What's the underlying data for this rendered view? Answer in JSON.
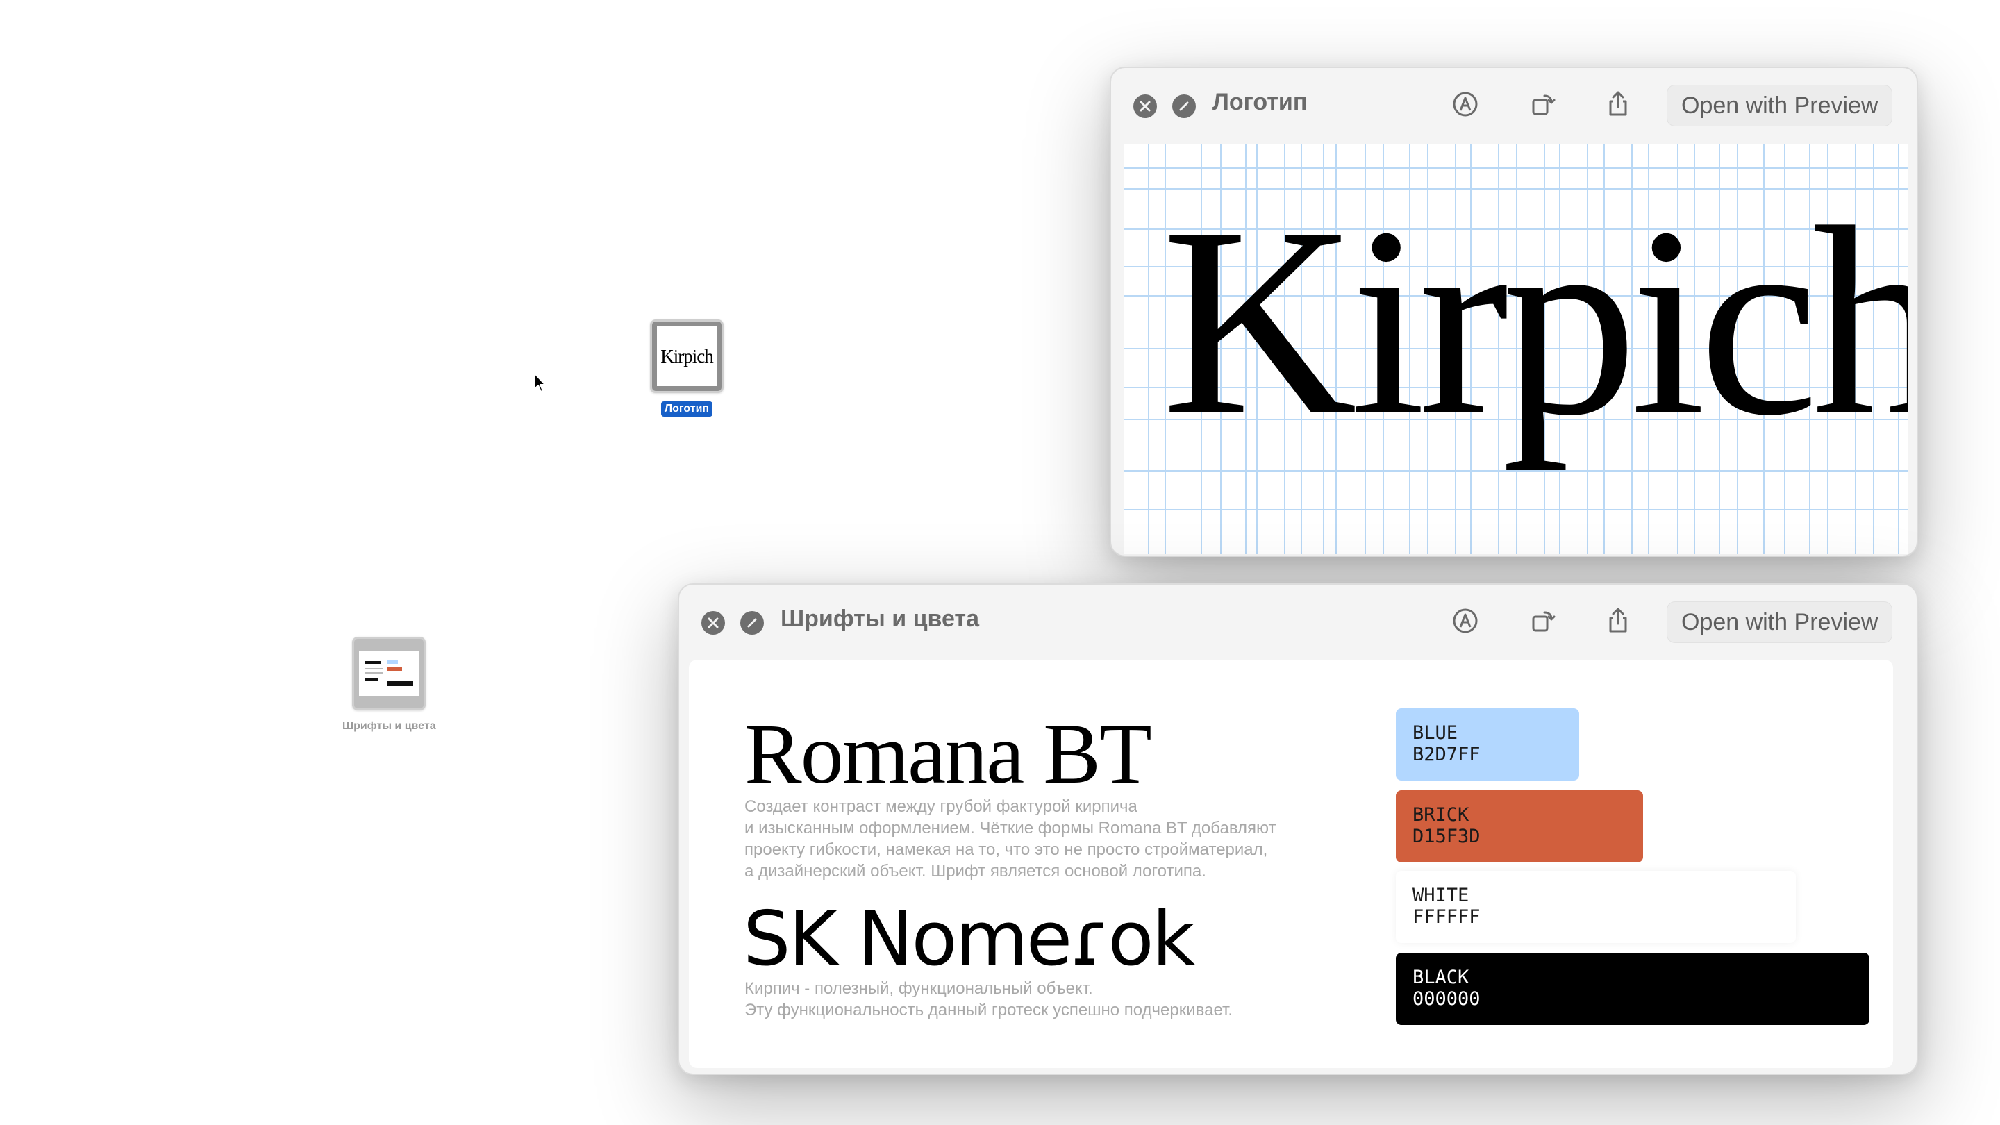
{
  "desktop": {
    "icons": [
      {
        "label": "Логотип",
        "thumb_text": "Kirpich",
        "selected": true
      },
      {
        "label": "Шрифты и цвета",
        "selected": false
      }
    ]
  },
  "logo_window": {
    "title": "Логотип",
    "open_button": "Open with Preview",
    "logo_text": "Kirpich"
  },
  "fonts_window": {
    "title": "Шрифты и цвета",
    "open_button": "Open with Preview",
    "fonts": [
      {
        "name": "Romana BT",
        "description": [
          "Создает контраст между грубой фактурой кирпича",
          "и изысканным оформлением. Чёткие формы Romana BT добавляют",
          "проекту гибкости, намекая на то, что это не просто стройматериал,",
          "а дизайнерский объект. Шрифт является основой логотипа."
        ]
      },
      {
        "name": "SK Nomeɾok",
        "description": [
          "Кирпич - полезный, функциональный объект.",
          "Эту функциональность данный гротеск успешно подчеркивает."
        ]
      }
    ],
    "colors": [
      {
        "name": "BLUE",
        "hex": "B2D7FF",
        "color": "#B2D7FF",
        "text_color": "#1a1a1a"
      },
      {
        "name": "BRICK",
        "hex": "D15F3D",
        "color": "#D15F3D",
        "text_color": "#1a1a1a"
      },
      {
        "name": "WHITE",
        "hex": "FFFFFF",
        "color": "#FFFFFF",
        "text_color": "#1a1a1a"
      },
      {
        "name": "BLACK",
        "hex": "000000",
        "color": "#000000",
        "text_color": "#ffffff"
      }
    ]
  },
  "icons": {
    "close": "close-icon",
    "fullscreen": "fullscreen-icon",
    "markup": "markup-icon",
    "rotate": "rotate-icon",
    "share": "share-icon"
  }
}
